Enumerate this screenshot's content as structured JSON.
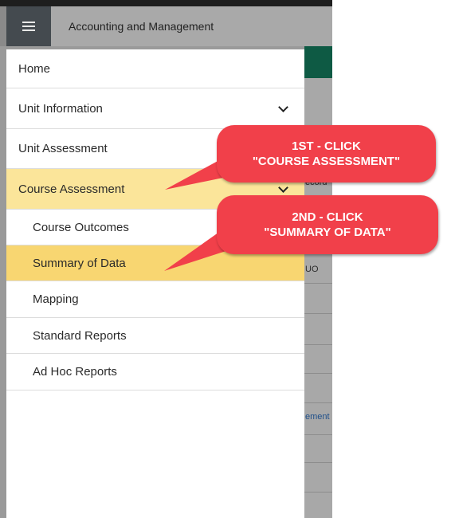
{
  "header": {
    "title": "Accounting and Management",
    "menu_icon": "hamburger-icon"
  },
  "background": {
    "snippets": [
      "ecord",
      "UO",
      "ement"
    ]
  },
  "menu": {
    "home": "Home",
    "unit_information": "Unit Information",
    "unit_assessment": "Unit Assessment",
    "course_assessment": "Course Assessment",
    "course_outcomes": "Course Outcomes",
    "summary_of_data": "Summary of Data",
    "mapping": "Mapping",
    "standard_reports": "Standard Reports",
    "ad_hoc_reports": "Ad Hoc Reports"
  },
  "callouts": {
    "first": {
      "line1": "1ST - CLICK",
      "line2": "\"COURSE ASSESSMENT\""
    },
    "second": {
      "line1": "2ND - CLICK",
      "line2": "\"SUMMARY OF DATA\""
    }
  },
  "colors": {
    "active_item": "#fbe59a",
    "selected_item": "#f8d671",
    "callout": "#f1404a",
    "header_button": "#444a4f"
  }
}
